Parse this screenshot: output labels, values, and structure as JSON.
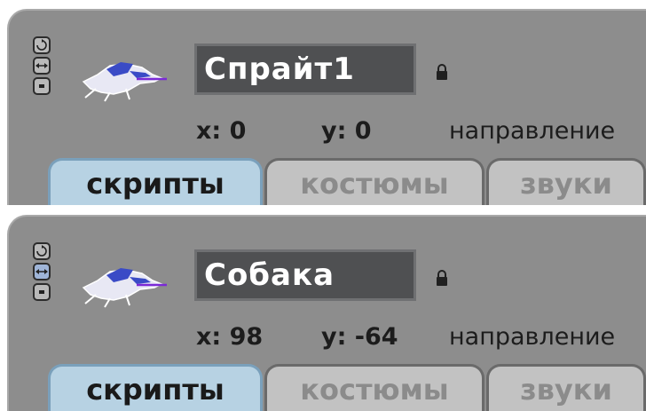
{
  "panels": [
    {
      "sprite_name": "Спрайт1",
      "x_label": "x: 0",
      "y_label": "y: 0",
      "direction_label": "направление",
      "tabs": [
        "скрипты",
        "костюмы",
        "звуки"
      ],
      "rotation_style_active": "rotate"
    },
    {
      "sprite_name": "Собака",
      "x_label": "x: 98",
      "y_label": "y: -64",
      "direction_label": "направление",
      "tabs": [
        "скрипты",
        "костюмы",
        "звуки"
      ],
      "rotation_style_active": "left-right"
    }
  ],
  "active_tab": "скрипты",
  "icons": {
    "rotate": "rotate-style-icon",
    "left_right": "left-right-style-icon",
    "no_rotate": "no-rotate-style-icon",
    "lock": "lock-icon",
    "thumbnail": "sprite-thumbnail-dog"
  },
  "colors": {
    "panel_bg": "#8d8d8d",
    "name_box_bg": "#4f5052",
    "active_tab_bg": "#b7d2e3",
    "inactive_tab_bg": "#c2c2c2"
  }
}
